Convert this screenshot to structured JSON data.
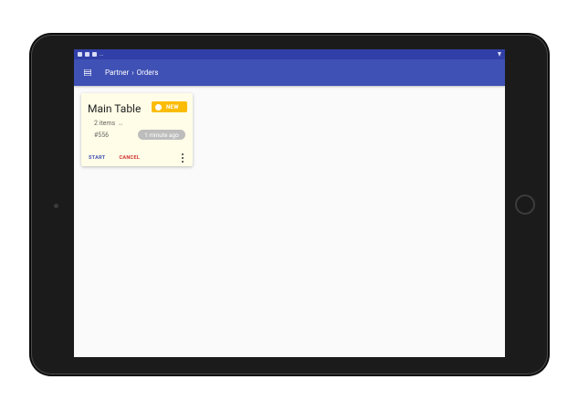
{
  "status_bar": {
    "left_icons": [
      "anchor-icon",
      "app-icon",
      "app-icon",
      "more-dots-icon"
    ],
    "right_icon": "signal-icon"
  },
  "app_bar": {
    "menu_icon": "menu-icon",
    "breadcrumb": {
      "root": "Partner",
      "separator": "›",
      "current": "Orders"
    },
    "color": "#3f51b5"
  },
  "order_card": {
    "title": "Main Table",
    "badge": "NEW",
    "badge_color": "#fbbc05",
    "items_count": "2 items",
    "items_icon": "expand-icon",
    "order_number": "#556",
    "time_ago": "1 minute ago",
    "actions": {
      "start": "START",
      "cancel": "CANCEL"
    },
    "more_icon": "more-vertical-icon",
    "background_color": "#fffde7"
  }
}
